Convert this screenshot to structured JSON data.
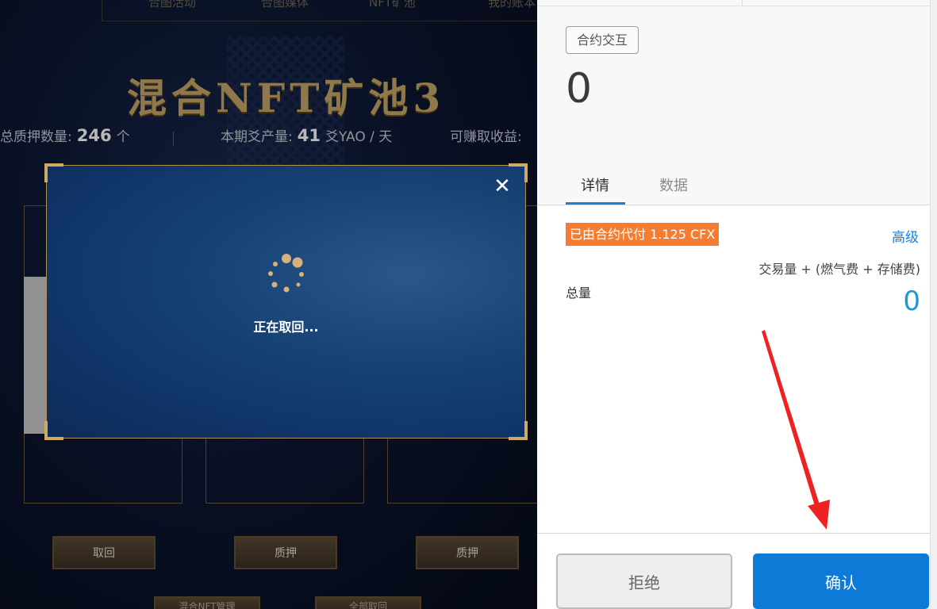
{
  "background": {
    "nav_items": [
      "合图活动",
      "合图媒体",
      "NFT矿池",
      "我的账本"
    ],
    "title": "混合NFT矿池3",
    "stats": {
      "staked_label": "总质押数量:",
      "staked_value": "246",
      "staked_unit": "个",
      "output_label": "本期爻产量:",
      "output_value": "41",
      "output_unit": "爻YAO / 天",
      "earn_label": "可赚取收益:"
    },
    "card_buttons": [
      "取回",
      "质押",
      "质押"
    ],
    "bottom_buttons": [
      "混合NFT管理",
      "全部取回"
    ]
  },
  "modal": {
    "status_text": "正在取回...",
    "close_icon": "close-icon",
    "spinner_icon": "loading-spinner-icon"
  },
  "wallet": {
    "interaction_tag": "合约交互",
    "amount": "0",
    "tabs": [
      "详情",
      "数据"
    ],
    "active_tab": "详情",
    "sponsor_badge": "已由合约代付 1.125 CFX",
    "advanced_link": "高级",
    "fee_formula": "交易量 + (燃气费 + 存储费)",
    "total_label": "总量",
    "total_value": "0",
    "reject_button": "拒绝",
    "confirm_button": "确认"
  },
  "colors": {
    "accent_blue": "#0d7ad7",
    "sponsor_orange": "#f57c31",
    "annotation_red": "#ee2222",
    "gold": "#c7a766"
  }
}
